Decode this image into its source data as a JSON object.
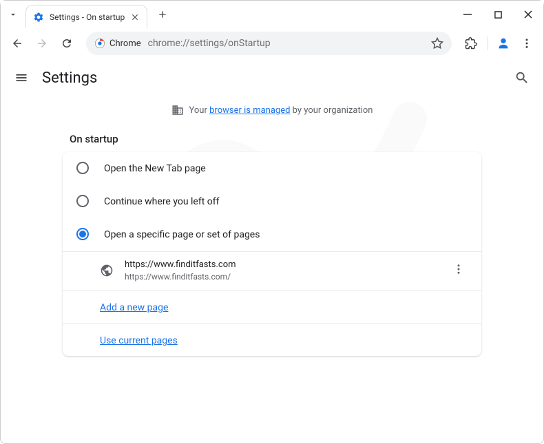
{
  "titlebar": {
    "tab_title": "Settings - On startup"
  },
  "toolbar": {
    "chip_label": "Chrome",
    "url": "chrome://settings/onStartup"
  },
  "header": {
    "title": "Settings"
  },
  "managed": {
    "prefix": "Your ",
    "link": "browser is managed",
    "suffix": " by your organization"
  },
  "section": {
    "title": "On startup"
  },
  "options": {
    "opt1": "Open the New Tab page",
    "opt2": "Continue where you left off",
    "opt3": "Open a specific page or set of pages"
  },
  "page": {
    "title": "https://www.finditfasts.com",
    "url": "https://www.finditfasts.com/"
  },
  "links": {
    "add": "Add a new page",
    "use_current": "Use current pages"
  }
}
